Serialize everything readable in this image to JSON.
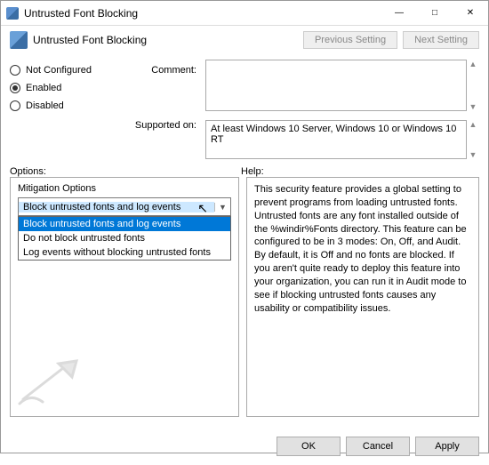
{
  "window": {
    "title": "Untrusted Font Blocking"
  },
  "header": {
    "policy_name": "Untrusted Font Blocking",
    "previous": "Previous Setting",
    "next": "Next Setting"
  },
  "config": {
    "radios": {
      "not_configured": "Not Configured",
      "enabled": "Enabled",
      "disabled": "Disabled",
      "selected": "enabled"
    },
    "comment_label": "Comment:",
    "comment_value": "",
    "supported_label": "Supported on:",
    "supported_value": "At least Windows 10 Server, Windows 10 or Windows 10 RT"
  },
  "labels": {
    "options": "Options:",
    "help": "Help:"
  },
  "options": {
    "group_label": "Mitigation Options",
    "selected": "Block untrusted fonts and log events",
    "items": [
      "Block untrusted fonts and log events",
      "Do not block untrusted fonts",
      "Log events without blocking untrusted fonts"
    ]
  },
  "help": {
    "text": "This security feature provides a global setting to prevent programs from loading untrusted fonts. Untrusted fonts are any font installed outside of the %windir%Fonts directory. This feature can be configured to be in 3 modes: On, Off, and Audit. By default, it is Off and no fonts are blocked. If you aren't quite ready to deploy this feature into your organization, you can run it in Audit mode to see if blocking untrusted fonts causes any usability or compatibility issues."
  },
  "footer": {
    "ok": "OK",
    "cancel": "Cancel",
    "apply": "Apply"
  }
}
